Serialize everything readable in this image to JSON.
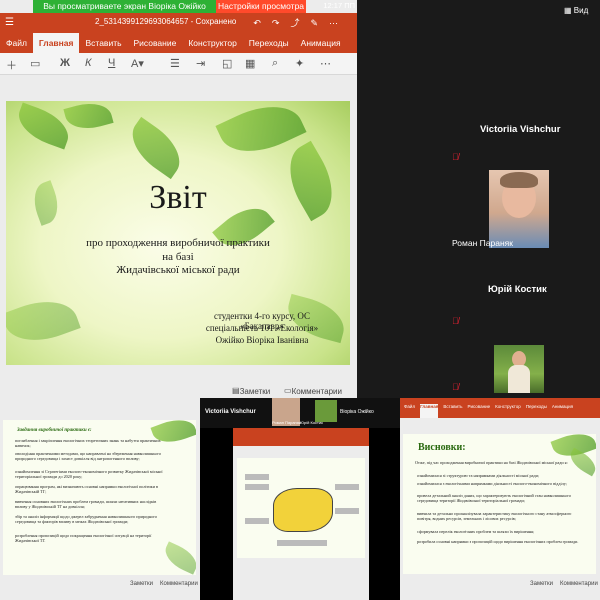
{
  "share": {
    "banner_text": "Вы просматриваете экран Віоріка Ожійко",
    "view_settings": "Настройки просмотра",
    "status_time": "12:17 ПП"
  },
  "ppt": {
    "filename": "2_5314399129693064657 - Сохранено",
    "tabs": [
      "Файл",
      "Главная",
      "Вставить",
      "Рисование",
      "Конструктор",
      "Переходы",
      "Анимация"
    ],
    "active_tab": "Главная",
    "status_notes": "Заметки",
    "status_comments": "Комментарии"
  },
  "slide": {
    "title": "Звіт",
    "line1": "про проходження виробничої практики",
    "line2": "на базі",
    "line3": "Жидачівської міської ради",
    "author1": "студентки 4-го курсу, ОС «Бакалавр»",
    "author2": "спеціальність 101 «Екологія»",
    "author3": "Ожійко Віоріка Іванівна"
  },
  "participants": {
    "gallery_label": "Вид",
    "p1": "Victoriia Vishchur",
    "p2": "Роман Параняк",
    "p3": "Юрій Костик"
  },
  "thumb1": {
    "heading": "Завдання виробничої практики є:",
    "bullets": [
      "поглиблення і закріплення екологічних теоретичних знань та набуття практичних навичок;",
      "оволодіння практичними методами, що направлені на збереження навколишнього природного середовища і захист довкілля від антропогенного впливу;",
      "ознайомлення зі Стратегіями еколого-економічного розвитку Жидачівської міської територіальної громади до 2020 року;",
      "опрацювання програм, які визначають основні напрямки екологічної політики в Жидачівській ТГ;",
      "вивчення основних екологічних проблем громади, шляхи негативних наслідків впливу у Жидачівській ТГ на довкілля;",
      "збір та аналіз інформації щодо джерел забруднення навколишнього природного середовища та факторів впливу в межах Жидачівської громади;",
      "розроблення пропозицій щодо покращення екологічної ситуації на території Жидачівської ТГ."
    ],
    "notes": "Заметки",
    "comments": "Комментарии"
  },
  "thumb2": {
    "name1": "Victoriia Vishchur",
    "name2": "Віоріка Ожійко",
    "name3": "Роман Параняк",
    "name4": "Юрій Костик"
  },
  "thumb3": {
    "tabs": [
      "Файл",
      "Главная",
      "Вставить",
      "Рисование",
      "Конструктор",
      "Переходы",
      "Анимация"
    ],
    "heading": "Висновки:",
    "intro": "Отже, під час проходження виробничої практики на базі Жидачівської міської ради я:",
    "bullets": [
      "ознайомилася зі структурою та напрямками діяльності міської ради;",
      "ознайомилася з екологічними напрямками діяльності еколого-економічного відділу;",
      "провела детальний аналіз даних, що характеризують екологічний стан навколишнього середовища території Жидачівської територіальної громади;",
      "вивчила та детально проаналізувала характеристику екологічного стану атмосферного повітря, водних ресурсів, земельних і лісових ресурсів;",
      "сформувала перелік екологічних проблем та шляхи їх вирішення;",
      "розробила основні напрямки з пропозицій щодо вирішення екологічних проблем громади."
    ],
    "notes": "Заметки",
    "comments": "Комментарии"
  }
}
